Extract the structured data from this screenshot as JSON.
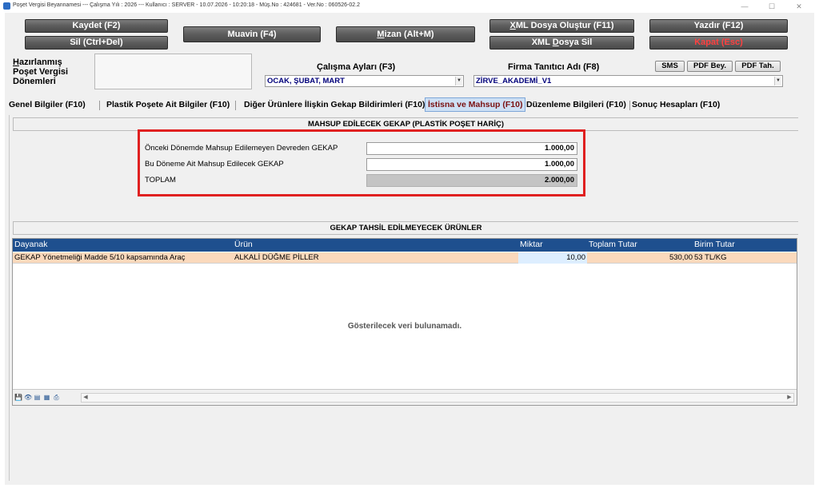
{
  "window": {
    "title": "Poşet Vergisi Beyannamesi  ---  Çalışma Yılı : 2026  ---  Kullanıcı : SERVER - 10.07.2026 - 10:20:18 - Müş.No : 424681 - Ver.No : 060526-02.2",
    "minimize": "—",
    "maximize": "☐",
    "close": "✕"
  },
  "toolbar": {
    "save": "Kaydet (F2)",
    "delete": "Sil (Ctrl+Del)",
    "muavin": "Muavin (F4)",
    "mizan_underlined": "M",
    "mizan_rest": "izan (Alt+M)",
    "xml_create_underlined": "X",
    "xml_create_rest": "ML Dosya Oluştur (F11)",
    "xml_delete_pre": "XML ",
    "xml_delete_underlined": "D",
    "xml_delete_rest": "osya Sil",
    "print": "Yazdır (F12)",
    "close": "Kapat (Esc)"
  },
  "prepared": {
    "label_u": "H",
    "label_rest": "azırlanmış",
    "label_line2": "Poşet Vergisi",
    "label_line3": "Dönemleri"
  },
  "period": {
    "label": "Çalışma Ayları (F3)",
    "value": "OCAK, ŞUBAT, MART"
  },
  "company": {
    "label": "Firma Tanıtıcı Adı (F8)",
    "value": "ZİRVE_AKADEMİ_V1"
  },
  "small_buttons": {
    "sms": "SMS",
    "pdf_bey": "PDF Bey.",
    "pdf_tah": "PDF Tah."
  },
  "tabs": [
    {
      "label": "Genel Bilgiler (F10)"
    },
    {
      "label": "Plastik Poşete Ait Bilgiler (F10)"
    },
    {
      "label": "Diğer Ürünlere İlişkin Gekap Bildirimleri (F10)"
    },
    {
      "label": "İstisna ve Mahsup (F10)"
    },
    {
      "label": "Düzenleme Bilgileri (F10)"
    },
    {
      "label": "Sonuç Hesapları (F10)"
    }
  ],
  "mahsup": {
    "header": "MAHSUP EDİLECEK GEKAP (PLASTİK POŞET HARİÇ)",
    "rows": [
      {
        "label": "Önceki Dönemde Mahsup Edilemeyen Devreden GEKAP",
        "value": "1.000,00"
      },
      {
        "label": "Bu Döneme Ait Mahsup Edilecek GEKAP",
        "value": "1.000,00"
      },
      {
        "label": "TOPLAM",
        "value": "2.000,00"
      }
    ]
  },
  "gekap_table": {
    "header": "GEKAP TAHSİL EDİLMEYECEK ÜRÜNLER",
    "columns": [
      "Dayanak",
      "Ürün",
      "Miktar",
      "Toplam Tutar",
      "Birim Tutar"
    ],
    "rows": [
      {
        "dayanak": "GEKAP Yönetmeliği Madde 5/10 kapsamında Araç",
        "urun": "ALKALİ DÜĞME PİLLER",
        "miktar": "10,00",
        "toplam": "530,00",
        "birim": "53 TL/KG"
      }
    ],
    "empty_message": "Gösterilecek veri bulunamadı."
  },
  "icons": {
    "save": "💾",
    "view": "👁",
    "export1": "▤",
    "export2": "▦",
    "print": "⎙",
    "scroll_left": "◀",
    "scroll_right": "▶",
    "combo_arrow": "▼"
  }
}
